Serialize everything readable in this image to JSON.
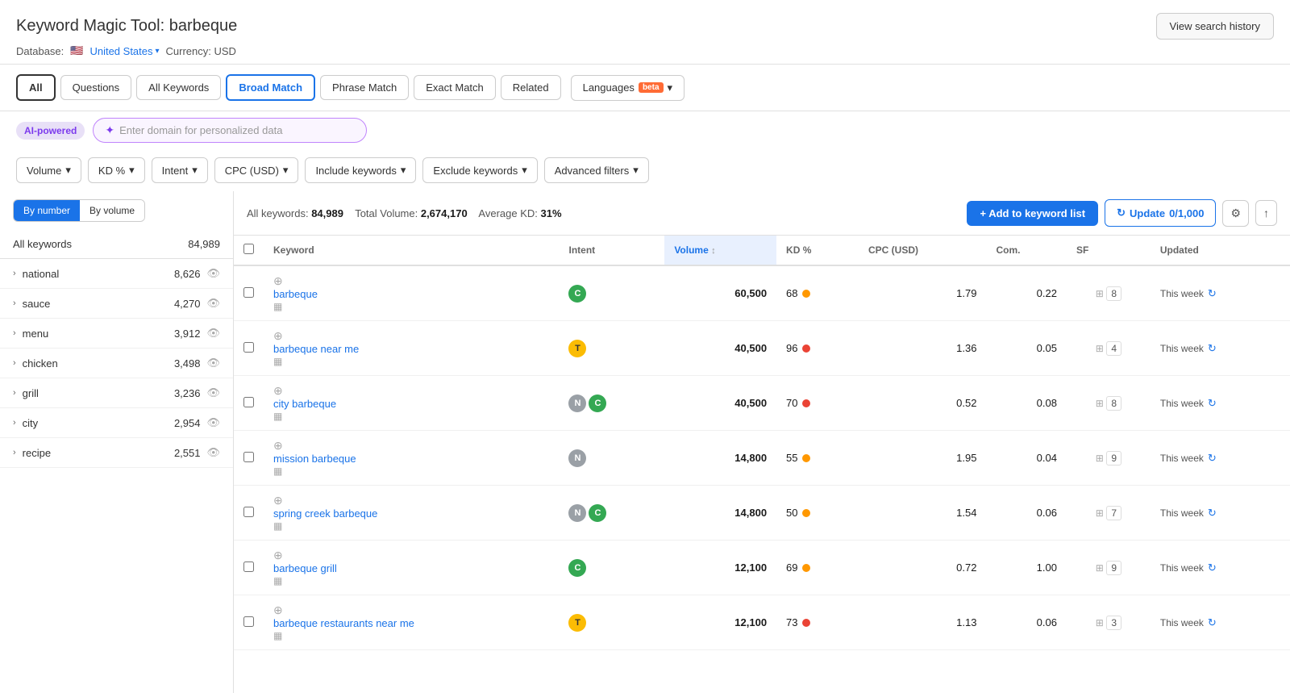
{
  "header": {
    "title_prefix": "Keyword Magic Tool:",
    "keyword": "barbeque",
    "view_history_label": "View search history",
    "database_label": "Database:",
    "database_flag": "🇺🇸",
    "database_link": "United States",
    "currency_label": "Currency: USD"
  },
  "tabs": {
    "items": [
      {
        "id": "all",
        "label": "All",
        "active": true
      },
      {
        "id": "questions",
        "label": "Questions",
        "active": false
      },
      {
        "id": "all-keywords",
        "label": "All Keywords",
        "active": false
      },
      {
        "id": "broad-match",
        "label": "Broad Match",
        "active": true
      },
      {
        "id": "phrase-match",
        "label": "Phrase Match",
        "active": false
      },
      {
        "id": "exact-match",
        "label": "Exact Match",
        "active": false
      },
      {
        "id": "related",
        "label": "Related",
        "active": false
      }
    ],
    "languages_label": "Languages",
    "languages_beta": "beta"
  },
  "ai_row": {
    "badge_label": "AI-powered",
    "input_placeholder": "Enter domain for personalized data"
  },
  "filters": {
    "items": [
      {
        "id": "volume",
        "label": "Volume"
      },
      {
        "id": "kd",
        "label": "KD %"
      },
      {
        "id": "intent",
        "label": "Intent"
      },
      {
        "id": "cpc",
        "label": "CPC (USD)"
      },
      {
        "id": "include",
        "label": "Include keywords"
      },
      {
        "id": "exclude",
        "label": "Exclude keywords"
      },
      {
        "id": "advanced",
        "label": "Advanced filters"
      }
    ]
  },
  "sort_buttons": {
    "by_number": "By number",
    "by_volume": "By volume"
  },
  "sidebar": {
    "all_label": "All keywords",
    "all_count": "84,989",
    "items": [
      {
        "label": "national",
        "count": "8,626"
      },
      {
        "label": "sauce",
        "count": "4,270"
      },
      {
        "label": "menu",
        "count": "3,912"
      },
      {
        "label": "chicken",
        "count": "3,498"
      },
      {
        "label": "grill",
        "count": "3,236"
      },
      {
        "label": "city",
        "count": "2,954"
      },
      {
        "label": "recipe",
        "count": "2,551"
      }
    ]
  },
  "content": {
    "stats": {
      "all_keywords_label": "All keywords:",
      "all_keywords_value": "84,989",
      "total_volume_label": "Total Volume:",
      "total_volume_value": "2,674,170",
      "avg_kd_label": "Average KD:",
      "avg_kd_value": "31%"
    },
    "actions": {
      "add_btn": "+ Add to keyword list",
      "update_btn": "Update",
      "update_count": "0/1,000"
    },
    "table": {
      "columns": [
        "Keyword",
        "Intent",
        "Volume",
        "KD %",
        "CPC (USD)",
        "Com.",
        "SF",
        "Updated"
      ],
      "rows": [
        {
          "keyword": "barbeque",
          "intents": [
            {
              "code": "C",
              "type": "c"
            }
          ],
          "volume": "60,500",
          "kd": 68,
          "kd_color": "orange",
          "cpc": "1.79",
          "com": "0.22",
          "sf": "8",
          "updated": "This week"
        },
        {
          "keyword": "barbeque near me",
          "intents": [
            {
              "code": "T",
              "type": "t"
            }
          ],
          "volume": "40,500",
          "kd": 96,
          "kd_color": "red",
          "cpc": "1.36",
          "com": "0.05",
          "sf": "4",
          "updated": "This week"
        },
        {
          "keyword": "city barbeque",
          "intents": [
            {
              "code": "N",
              "type": "n"
            },
            {
              "code": "C",
              "type": "c"
            }
          ],
          "volume": "40,500",
          "kd": 70,
          "kd_color": "red",
          "cpc": "0.52",
          "com": "0.08",
          "sf": "8",
          "updated": "This week"
        },
        {
          "keyword": "mission barbeque",
          "intents": [
            {
              "code": "N",
              "type": "n"
            }
          ],
          "volume": "14,800",
          "kd": 55,
          "kd_color": "orange",
          "cpc": "1.95",
          "com": "0.04",
          "sf": "9",
          "updated": "This week"
        },
        {
          "keyword": "spring creek barbeque",
          "intents": [
            {
              "code": "N",
              "type": "n"
            },
            {
              "code": "C",
              "type": "c"
            }
          ],
          "volume": "14,800",
          "kd": 50,
          "kd_color": "orange",
          "cpc": "1.54",
          "com": "0.06",
          "sf": "7",
          "updated": "This week"
        },
        {
          "keyword": "barbeque grill",
          "intents": [
            {
              "code": "C",
              "type": "c"
            }
          ],
          "volume": "12,100",
          "kd": 69,
          "kd_color": "orange",
          "cpc": "0.72",
          "com": "1.00",
          "sf": "9",
          "updated": "This week"
        },
        {
          "keyword": "barbeque restaurants near me",
          "intents": [
            {
              "code": "T",
              "type": "t"
            }
          ],
          "volume": "12,100",
          "kd": 73,
          "kd_color": "red",
          "cpc": "1.13",
          "com": "0.06",
          "sf": "3",
          "updated": "This week"
        }
      ]
    }
  }
}
